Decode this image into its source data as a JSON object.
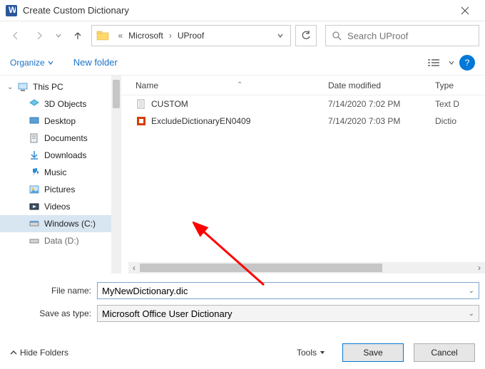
{
  "title": "Create Custom Dictionary",
  "breadcrumb": {
    "sep": "«",
    "p1": "Microsoft",
    "p2": "UProof"
  },
  "search": {
    "placeholder": "Search UProof"
  },
  "toolbar": {
    "organize": "Organize",
    "newfolder": "New folder"
  },
  "tree": {
    "thispc": "This PC",
    "objects3d": "3D Objects",
    "desktop": "Desktop",
    "documents": "Documents",
    "downloads": "Downloads",
    "music": "Music",
    "pictures": "Pictures",
    "videos": "Videos",
    "windowsc": "Windows (C:)",
    "datad": "Data (D:)"
  },
  "columns": {
    "name": "Name",
    "modified": "Date modified",
    "type": "Type"
  },
  "files": [
    {
      "name": "CUSTOM",
      "modified": "7/14/2020 7:02 PM",
      "type": "Text D",
      "icon": "file"
    },
    {
      "name": "ExcludeDictionaryEN0409",
      "modified": "7/14/2020 7:03 PM",
      "type": "Dictio",
      "icon": "office"
    }
  ],
  "form": {
    "filename_label": "File name:",
    "filename_value": "MyNewDictionary.dic",
    "saveas_label": "Save as type:",
    "saveas_value": "Microsoft Office User Dictionary"
  },
  "footer": {
    "hide": "Hide Folders",
    "tools": "Tools",
    "save": "Save",
    "cancel": "Cancel"
  },
  "help": "?"
}
